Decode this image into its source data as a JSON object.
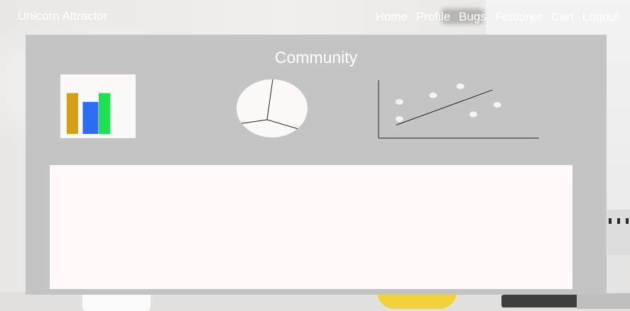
{
  "app": {
    "brand": "Unicorn Attractor"
  },
  "nav": {
    "items": [
      {
        "label": "Home"
      },
      {
        "label": "Profile"
      },
      {
        "label": "Bugs"
      },
      {
        "label": "Features"
      },
      {
        "label": "Cart"
      },
      {
        "label": "Logout"
      }
    ]
  },
  "page": {
    "title": "Community"
  },
  "colors": {
    "panel": "#c4c4c4",
    "bar_1": "#d69e12",
    "bar_2": "#2e6cf6",
    "bar_3": "#1de24f",
    "chart_bg": "#fbf8f7"
  },
  "chart_data": [
    {
      "type": "bar",
      "categories": [
        "",
        "",
        ""
      ],
      "values": [
        60,
        47,
        60
      ],
      "ylim": [
        0,
        75
      ],
      "colors": [
        "#d69e12",
        "#2e6cf6",
        "#1de24f"
      ],
      "title": "",
      "xlabel": "",
      "ylabel": ""
    },
    {
      "type": "pie",
      "labels": [
        "",
        "",
        ""
      ],
      "values": [
        0.37,
        0.29,
        0.34
      ],
      "title": ""
    },
    {
      "type": "scatter",
      "points": [
        {
          "x": 0.13,
          "y": 0.61
        },
        {
          "x": 0.13,
          "y": 0.32
        },
        {
          "x": 0.34,
          "y": 0.72
        },
        {
          "x": 0.51,
          "y": 0.87
        },
        {
          "x": 0.59,
          "y": 0.4
        },
        {
          "x": 0.74,
          "y": 0.56
        }
      ],
      "trendline": {
        "x": [
          0.11,
          0.71
        ],
        "y": [
          0.22,
          0.81
        ]
      },
      "xlim": [
        0,
        1
      ],
      "ylim": [
        0,
        1
      ],
      "title": "",
      "xlabel": "",
      "ylabel": ""
    }
  ]
}
